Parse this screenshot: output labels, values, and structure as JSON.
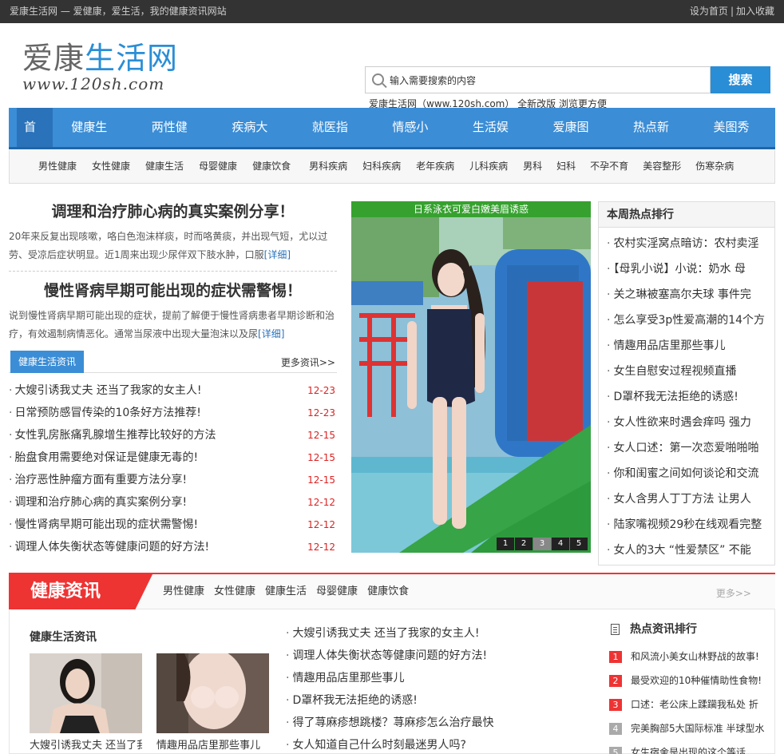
{
  "topbar": {
    "left": "爱康生活网 — 爱健康，爱生活，我的健康资讯网站",
    "set_home": "设为首页",
    "divider": "|",
    "bookmark": "加入收藏"
  },
  "logo": {
    "part1": "爱康",
    "part2": "生活网",
    "url": "www.120sh.com"
  },
  "search": {
    "value": "输入需要搜索的内容",
    "button": "搜索",
    "note": "爱康生活网（www.120sh.com） 全新改版 浏览更方便"
  },
  "nav": [
    "首页",
    "健康生活",
    "两性健康",
    "疾病大全",
    "就医指南",
    "情感小说",
    "生活娱乐",
    "爱康图库",
    "热点新闻",
    "美图秀场"
  ],
  "subnav": [
    "男性健康",
    "女性健康",
    "健康生活",
    "母婴健康",
    "健康饮食",
    "男科疾病",
    "妇科疾病",
    "老年疾病",
    "儿科疾病",
    "男科",
    "妇科",
    "不孕不育",
    "美容整形",
    "伤寒杂病"
  ],
  "featured": [
    {
      "title": "调理和治疗肺心病的真实案例分享！",
      "summary": "20年来反复出现咳嗽，咯白色泡沫样痰，时而咯黄痰，并出现气短，尤以过劳、受凉后症状明显。近1周来出现少尿伴双下肢水肿，口服",
      "more": "[详细]"
    },
    {
      "title": "慢性肾病早期可能出现的症状需警惕！",
      "summary": "说到慢性肾病早期可能出现的症状，提前了解便于慢性肾病患者早期诊断和治疗，有效遏制病情恶化。通常当尿液中出现大量泡沫以及尿",
      "more": "[详细]"
    }
  ],
  "section1": {
    "tag": "健康生活资讯",
    "more": "更多资讯>>"
  },
  "news": [
    {
      "title": "大嫂引诱我丈夫 还当了我家的女主人!",
      "date": "12-23"
    },
    {
      "title": "日常预防感冒传染的10条好方法推荐!",
      "date": "12-23"
    },
    {
      "title": "女性乳房胀痛乳腺增生推荐比较好的方法",
      "date": "12-15"
    },
    {
      "title": "胎盘食用需要绝对保证是健康无毒的!",
      "date": "12-15"
    },
    {
      "title": "治疗恶性肿瘤方面有重要方法分享!",
      "date": "12-15"
    },
    {
      "title": "调理和治疗肺心病的真实案例分享!",
      "date": "12-12"
    },
    {
      "title": "慢性肾病早期可能出现的症状需警惕!",
      "date": "12-12"
    },
    {
      "title": "调理人体失衡状态等健康问题的好方法!",
      "date": "12-12"
    }
  ],
  "slide": {
    "caption": "日系泳衣可爱白嫩美眉诱惑",
    "dots": [
      "1",
      "2",
      "3",
      "4",
      "5"
    ],
    "active": 3
  },
  "hot": {
    "title": "本周热点排行",
    "items": [
      "农村实淫窝点暗访：农村卖淫",
      "【母乳小说】小说：奶水 母",
      "关之琳被塞高尔夫球 事件完",
      "怎么享受3p性爱高潮的14个方",
      "情趣用品店里那些事儿",
      "女生自慰安过程视频直播",
      "D罩杯我无法拒绝的诱惑!",
      "女人性欲来时遇会痒吗 强力",
      "女人口述：第一次恋爱啪啪啪",
      "你和闺蜜之间如何谈论和交流",
      "女人含男人丁丁方法 让男人",
      "陆家嘴视频29秒在线观看完整",
      "女人的3大 “性爱禁区” 不能"
    ]
  },
  "band": {
    "title": "健康资讯",
    "tabs": [
      "男性健康",
      "女性健康",
      "健康生活",
      "母婴健康",
      "健康饮食"
    ],
    "more": "更多>>"
  },
  "lower": {
    "left_title": "健康生活资讯",
    "thumbs": [
      {
        "caption": "大嫂引诱我丈夫 还当了我"
      },
      {
        "caption": "情趣用品店里那些事儿"
      }
    ],
    "mid": [
      "大嫂引诱我丈夫 还当了我家的女主人!",
      "调理人体失衡状态等健康问题的好方法!",
      "情趣用品店里那些事儿",
      "D罩杯我无法拒绝的诱惑!",
      "得了荨麻疹想跳楼？荨麻疹怎么治疗最快",
      "女人知道自己什么时刻最迷男人吗?"
    ],
    "rank_title": "热点资讯排行",
    "rank": [
      {
        "n": "1",
        "t": "和风流小美女山林野战的故事!"
      },
      {
        "n": "2",
        "t": "最受欢迎的10种催情助性食物!"
      },
      {
        "n": "3",
        "t": "口述：老公床上蹂躏我私处 折"
      },
      {
        "n": "4",
        "t": "完美胸部5大国际标准 半球型水"
      },
      {
        "n": "5",
        "t": "女生宿舍是出现的这个等话"
      }
    ]
  },
  "colors": {
    "brand": "#3b8dd6",
    "accent": "#e33333",
    "date": "#dd2222"
  }
}
